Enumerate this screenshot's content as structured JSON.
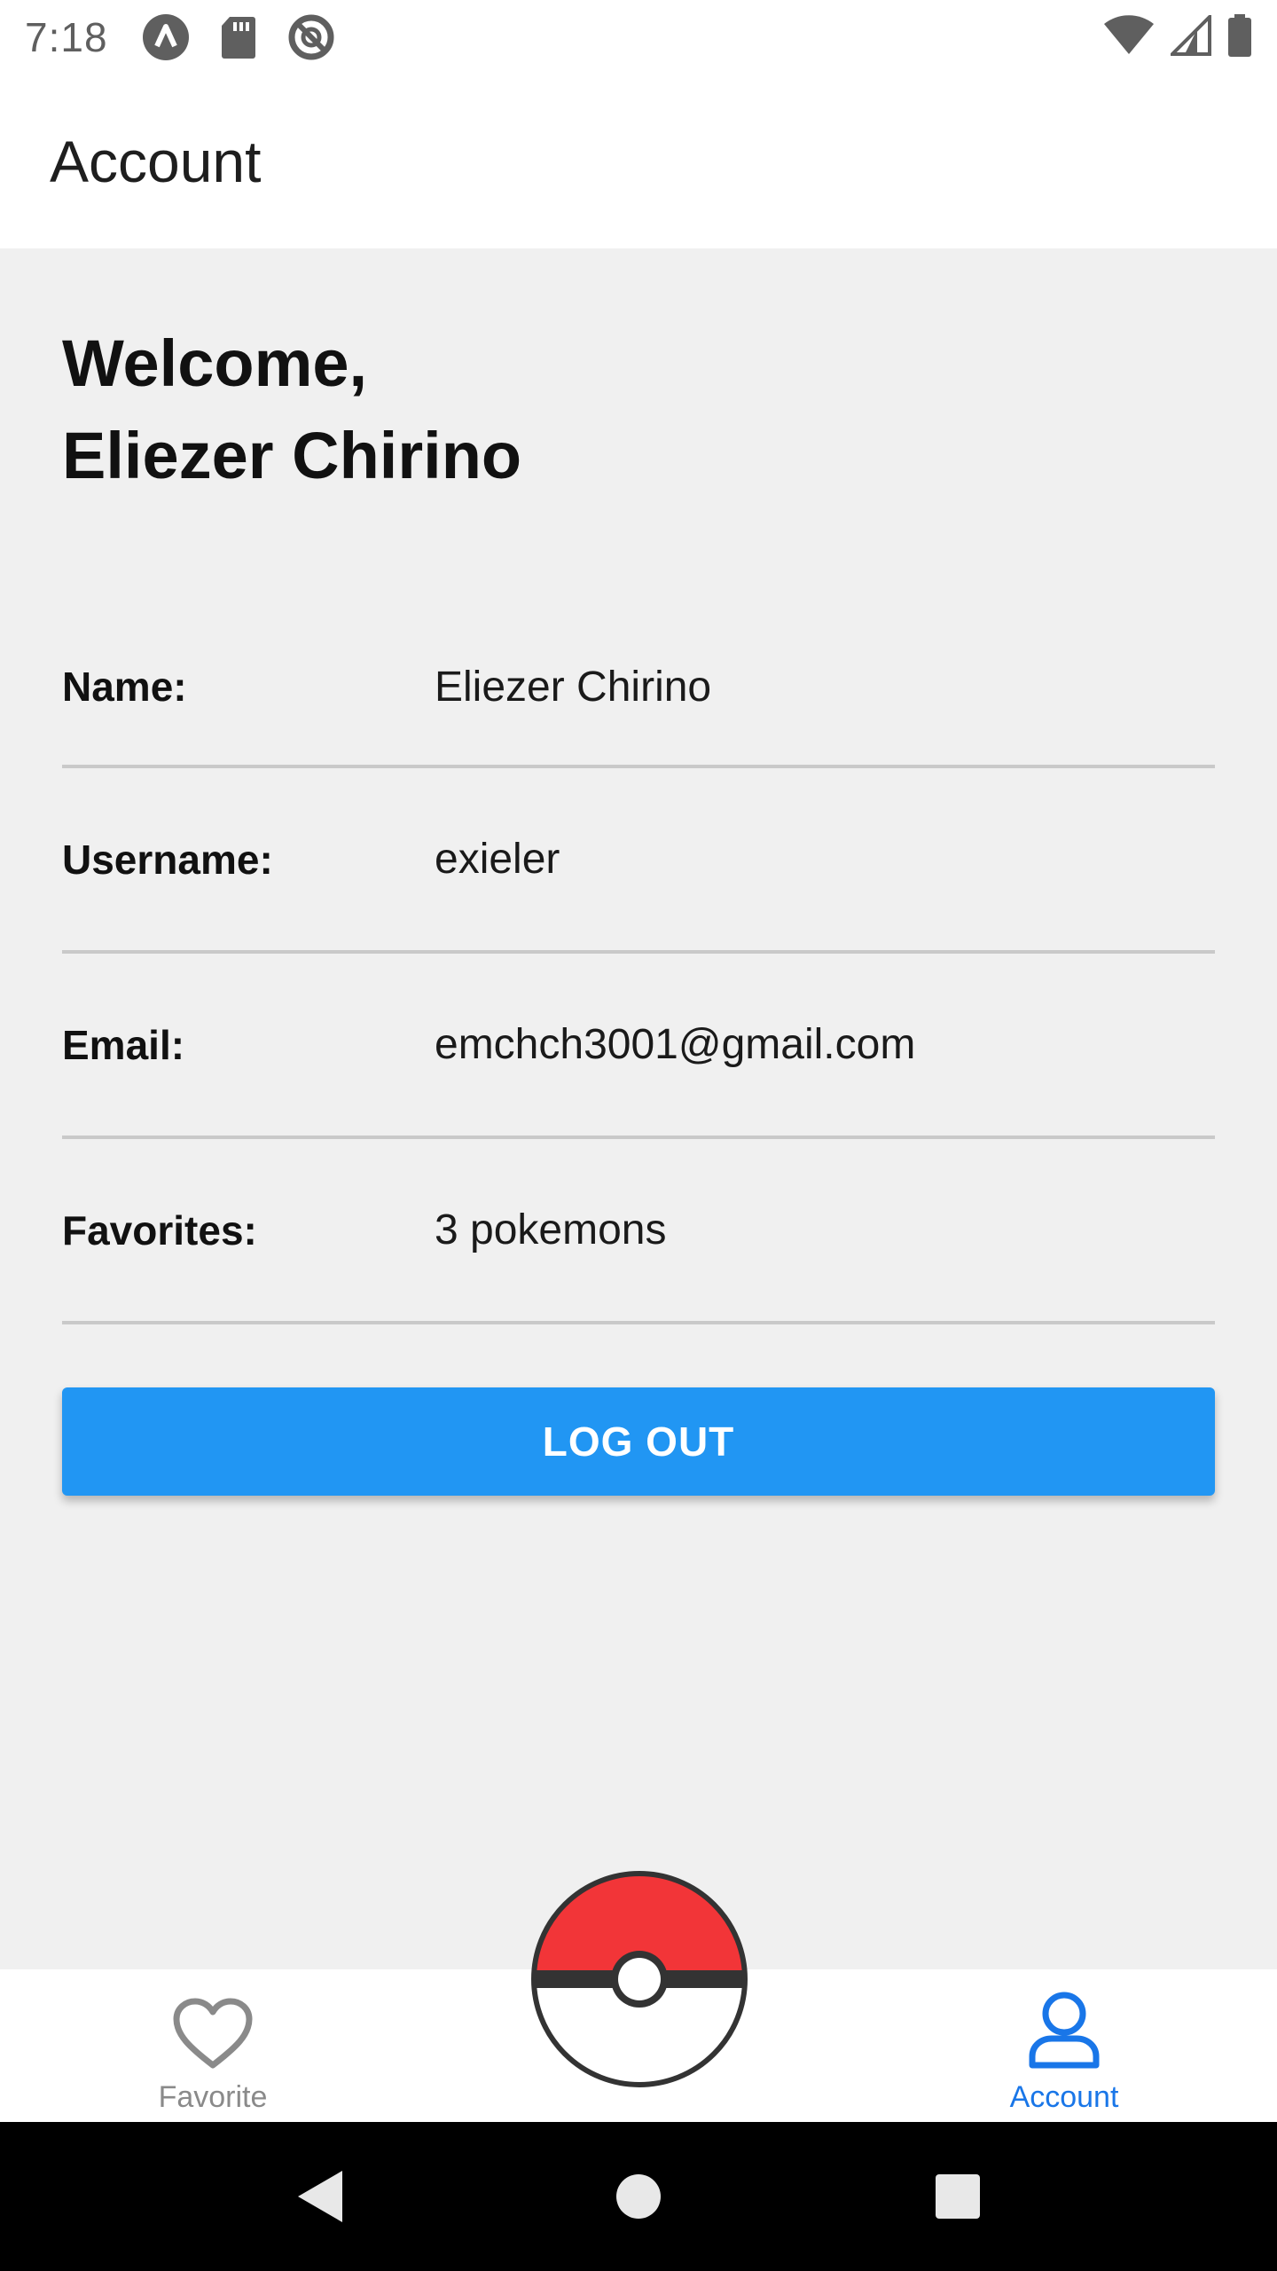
{
  "status_bar": {
    "time": "7:18",
    "left_icons": [
      "app-a-icon",
      "sd-card-icon",
      "do-not-disturb-icon"
    ],
    "right_icons": [
      "wifi-icon",
      "cell-signal-icon",
      "battery-icon"
    ]
  },
  "header": {
    "title": "Account"
  },
  "welcome": {
    "line1": "Welcome,",
    "line2": "Eliezer Chirino"
  },
  "info": [
    {
      "label": "Name:",
      "value": "Eliezer Chirino"
    },
    {
      "label": "Username:",
      "value": "exieler"
    },
    {
      "label": "Email:",
      "value": "emchch3001@gmail.com"
    },
    {
      "label": "Favorites:",
      "value": "3 pokemons"
    }
  ],
  "logout_label": "LOG OUT",
  "tabs": {
    "favorite": {
      "label": "Favorite",
      "icon": "heart-icon",
      "active": false
    },
    "center": {
      "icon": "pokeball-icon"
    },
    "account": {
      "label": "Account",
      "icon": "person-icon",
      "active": true
    }
  },
  "colors": {
    "accent": "#2196f3",
    "active_tab": "#1976e8",
    "inactive_tab": "#8a8a8a",
    "background": "#f0f0f0",
    "pokeball_red": "#f23538"
  },
  "nav_bar": {
    "icons": [
      "back-icon",
      "home-icon",
      "recents-icon"
    ]
  }
}
